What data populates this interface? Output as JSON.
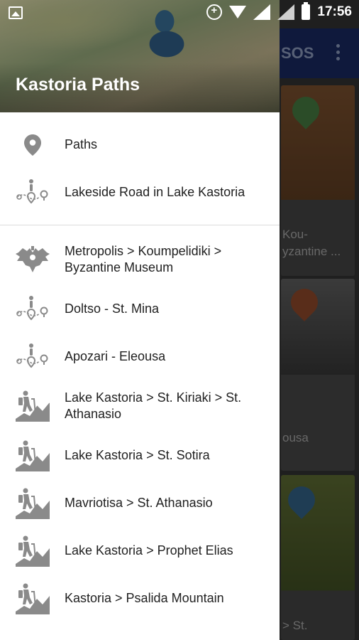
{
  "status_bar": {
    "time": "17:56",
    "icons": [
      "image-icon",
      "sync-icon",
      "wifi-icon",
      "signal-icon",
      "signal-icon",
      "battery-icon"
    ]
  },
  "background_app": {
    "toolbar_title_fragment": "SOS",
    "cards": [
      {
        "text_lines": [
          "Kou-",
          "yzantine ..."
        ]
      },
      {
        "text_lines": [
          "ousa"
        ]
      },
      {
        "text_lines": [
          "> St."
        ]
      }
    ]
  },
  "drawer": {
    "title": "Kastoria Paths",
    "primary_items": [
      {
        "label": "Paths",
        "icon": "location-pin-icon"
      },
      {
        "label": "Lakeside Road in Lake Kastoria",
        "icon": "route-walker-icon"
      }
    ],
    "paths": [
      {
        "label": "Metropolis > Koumpelidiki > Byzantine Museum",
        "icon": "double-headed-eagle-icon"
      },
      {
        "label": "Doltso - St. Mina",
        "icon": "route-walker-icon"
      },
      {
        "label": "Apozari - Eleousa",
        "icon": "route-walker-icon"
      },
      {
        "label": "Lake Kastoria > St. Kiriaki > St. Athanasio",
        "icon": "hiker-icon"
      },
      {
        "label": "Lake Kastoria > St. Sotira",
        "icon": "hiker-icon"
      },
      {
        "label": "Mavriotisa >  St. Athanasio",
        "icon": "hiker-icon"
      },
      {
        "label": "Lake Kastoria >  Prophet Elias",
        "icon": "hiker-icon"
      },
      {
        "label": "Kastoria > Psalida Mountain",
        "icon": "hiker-icon"
      }
    ]
  },
  "colors": {
    "toolbar": "#1c2f6e",
    "icon_gray": "#8a8a8a",
    "text": "#212121"
  }
}
